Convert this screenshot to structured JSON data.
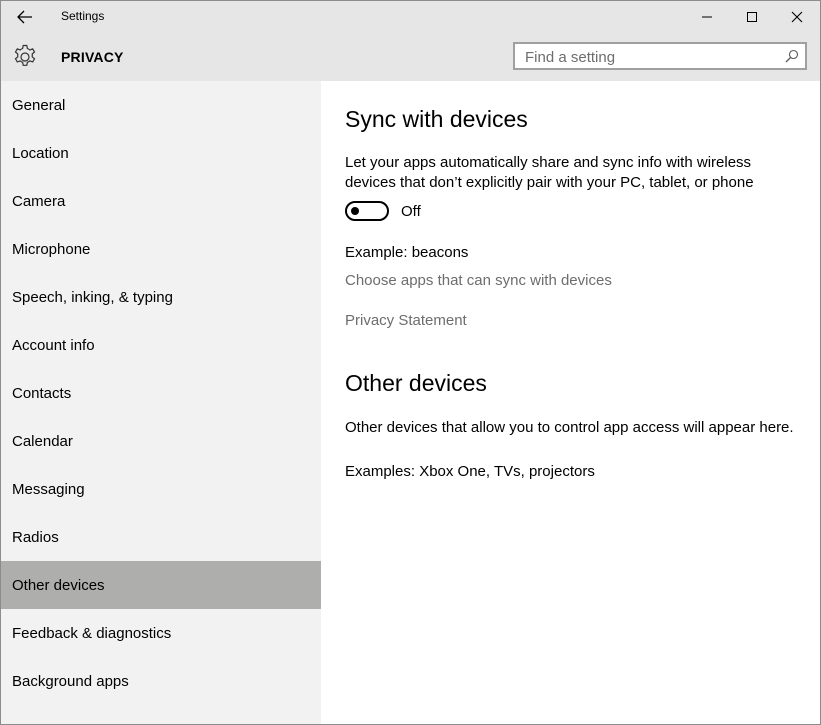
{
  "window": {
    "title": "Settings"
  },
  "header": {
    "section": "PRIVACY",
    "search_placeholder": "Find a setting"
  },
  "sidebar": {
    "items": [
      {
        "label": "General"
      },
      {
        "label": "Location"
      },
      {
        "label": "Camera"
      },
      {
        "label": "Microphone"
      },
      {
        "label": "Speech, inking, & typing"
      },
      {
        "label": "Account info"
      },
      {
        "label": "Contacts"
      },
      {
        "label": "Calendar"
      },
      {
        "label": "Messaging"
      },
      {
        "label": "Radios"
      },
      {
        "label": "Other devices",
        "selected": true
      },
      {
        "label": "Feedback & diagnostics"
      },
      {
        "label": "Background apps"
      }
    ]
  },
  "main": {
    "sync_heading": "Sync with devices",
    "sync_desc": "Let your apps automatically share and sync info with wireless devices that don’t explicitly pair with your PC, tablet, or phone",
    "toggle_state": "Off",
    "example": "Example: beacons",
    "choose_apps_link": "Choose apps that can sync with devices",
    "privacy_link": "Privacy Statement",
    "other_heading": "Other devices",
    "other_desc": "Other devices that allow you to control app access will appear here.",
    "other_examples": "Examples: Xbox One, TVs, projectors"
  },
  "icons": {
    "back": "back-arrow-icon",
    "minimize": "minimize-icon",
    "maximize": "maximize-icon",
    "close": "close-icon",
    "settings": "gear-icon",
    "search": "search-icon"
  },
  "colors": {
    "chrome": "#e6e6e6",
    "sidebar": "#f2f2f2",
    "selected": "#aeaeac",
    "link": "#6d6d6d"
  }
}
